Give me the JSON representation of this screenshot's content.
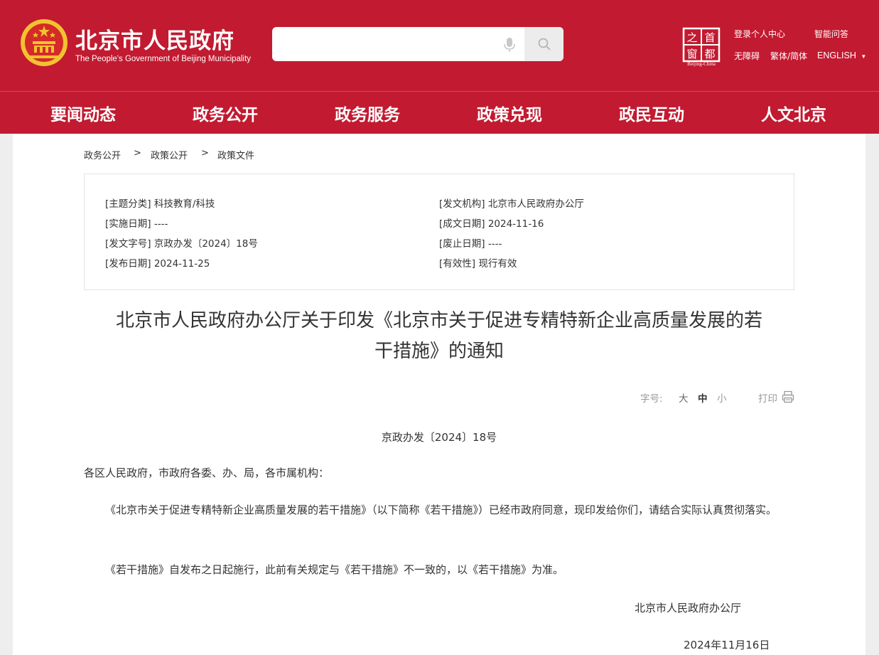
{
  "header": {
    "site_title": "北京市人民政府",
    "site_subtitle": "The People's Government of Beijing Municipality",
    "search": {
      "placeholder": ""
    },
    "capital_logo": {
      "chars": [
        "首",
        "之",
        "都",
        "窗"
      ],
      "sub": "Beijing-China"
    },
    "links": {
      "login": "登录个人中心",
      "smart_qa": "智能问答",
      "accessibility": "无障碍",
      "traditional_simplified": "繁体/简体",
      "english": "ENGLISH"
    }
  },
  "nav": {
    "items": [
      "要闻动态",
      "政务公开",
      "政务服务",
      "政策兑现",
      "政民互动",
      "人文北京"
    ]
  },
  "breadcrumb": {
    "items": [
      "政务公开",
      "政策公开",
      "政策文件"
    ],
    "separator": ">"
  },
  "meta": {
    "subject": "[主题分类] 科技教育/科技",
    "issuer": "[发文机构] 北京市人民政府办公厅",
    "effective_date": "[实施日期] ----",
    "written_date": "[成文日期] 2024-11-16",
    "doc_number": "[发文字号] 京政办发〔2024〕18号",
    "abolish_date": "[废止日期] ----",
    "publish_date": "[发布日期] 2024-11-25",
    "validity": "[有效性] 现行有效"
  },
  "document": {
    "title_line1": "北京市人民政府办公厅关于印发《北京市关于促进专精特新企业高质量发展的若",
    "title_line2": "干措施》的通知",
    "font_label": "字号:",
    "font_large": "大",
    "font_medium": "中",
    "font_small": "小",
    "print_label": "打印",
    "doc_number": "京政办发〔2024〕18号",
    "salutation": "各区人民政府，市政府各委、办、局，各市属机构：",
    "para1": "《北京市关于促进专精特新企业高质量发展的若干措施》（以下简称《若干措施》）已经市政府同意，现印发给你们，请结合实际认真贯彻落实。",
    "para2": "《若干措施》自发布之日起施行，此前有关规定与《若干措施》不一致的，以《若干措施》为准。",
    "signature": "北京市人民政府办公厅",
    "date": "2024年11月16日"
  },
  "colors": {
    "brand_red": "#c21a30",
    "emblem_gold": "#f2c230",
    "text": "#333333",
    "muted": "#999999",
    "page_bg": "#eeeeee"
  }
}
